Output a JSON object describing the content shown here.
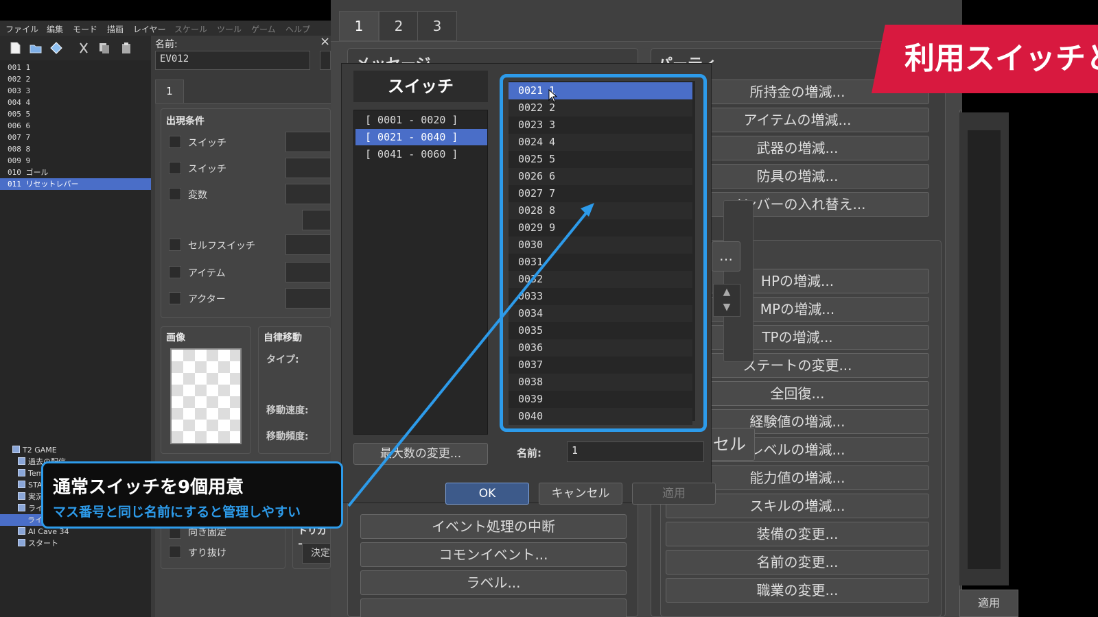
{
  "menu": {
    "items": [
      "ファイル",
      "編集",
      "モード",
      "描画",
      "レイヤー",
      "スケール",
      "ツール",
      "ゲーム",
      "ヘルプ"
    ]
  },
  "toolbar_icons": [
    "new-file-icon",
    "open-folder-icon",
    "save-icon",
    "cut-icon",
    "copy-icon",
    "paste-icon"
  ],
  "map_list": [
    {
      "label": "001 1"
    },
    {
      "label": "002 2"
    },
    {
      "label": "003 3"
    },
    {
      "label": "004 4"
    },
    {
      "label": "005 5"
    },
    {
      "label": "006 6"
    },
    {
      "label": "007 7"
    },
    {
      "label": "008 8"
    },
    {
      "label": "009 9"
    },
    {
      "label": "010 ゴール"
    },
    {
      "label": "011 リセットレバー",
      "selected": true
    }
  ],
  "project_tree": [
    {
      "label": "T2 GAME",
      "indent": 0
    },
    {
      "label": "過去の配信",
      "indent": 1
    },
    {
      "label": "Temp",
      "indent": 1
    },
    {
      "label": "STA",
      "indent": 1
    },
    {
      "label": "実況",
      "indent": 1
    },
    {
      "label": "ライ",
      "indent": 1
    },
    {
      "label": "ライ",
      "indent": 1,
      "selected": true
    },
    {
      "label": "AI Cave 34",
      "indent": 1
    },
    {
      "label": "スタート",
      "indent": 1
    }
  ],
  "event_editor": {
    "name_label": "名前:",
    "name_value": "EV012",
    "close_icon": "×",
    "page_tab": "1",
    "conditions_title": "出現条件",
    "conditions": [
      "スイッチ",
      "スイッチ",
      "変数",
      "セルフスイッチ",
      "アイテム",
      "アクター"
    ],
    "image_title": "画像",
    "autonomous_title": "自律移動",
    "type_label": "タイプ:",
    "speed_label": "移動速度:",
    "freq_label": "移動頻度:",
    "options": [
      "向き固定",
      "すり抜け"
    ],
    "trigger_title": "トリガー",
    "trigger_value": "決定"
  },
  "command_window": {
    "tabs": [
      "1",
      "2",
      "3"
    ],
    "message_title": "メッセージ",
    "party_title": "パーティ",
    "left_buttons": [
      "イベント処理の中断",
      "コモンイベント...",
      "ラベル..."
    ],
    "right_buttons": [
      "所持金の増減...",
      "アイテムの増減...",
      "武器の増減...",
      "防具の増減...",
      "メンバーの入れ替え...",
      "HPの増減...",
      "MPの増減...",
      "TPの増減...",
      "ステートの変更...",
      "全回復...",
      "経験値の増減...",
      "レベルの増減...",
      "能力値の増減...",
      "スキルの増減...",
      "装備の変更...",
      "名前の変更...",
      "職業の変更..."
    ],
    "cancel_partial": "ンセル",
    "apply_label": "適用"
  },
  "switch_dialog": {
    "title": "スイッチ",
    "groups": [
      {
        "label": "[ 0001 - 0020 ]"
      },
      {
        "label": "[ 0021 - 0040 ]",
        "selected": true
      },
      {
        "label": "[ 0041 - 0060 ]"
      }
    ],
    "switches": [
      {
        "label": "0021 1",
        "selected": true
      },
      {
        "label": "0022 2"
      },
      {
        "label": "0023 3"
      },
      {
        "label": "0024 4"
      },
      {
        "label": "0025 5"
      },
      {
        "label": "0026 6"
      },
      {
        "label": "0027 7"
      },
      {
        "label": "0028 8"
      },
      {
        "label": "0029 9"
      },
      {
        "label": "0030"
      },
      {
        "label": "0031"
      },
      {
        "label": "0032"
      },
      {
        "label": "0033"
      },
      {
        "label": "0034"
      },
      {
        "label": "0035"
      },
      {
        "label": "0036"
      },
      {
        "label": "0037"
      },
      {
        "label": "0038"
      },
      {
        "label": "0039"
      },
      {
        "label": "0040"
      }
    ],
    "max_change_label": "最大数の変更...",
    "name_label": "名前:",
    "name_value": "1",
    "ok_label": "OK",
    "cancel_label": "キャンセル",
    "apply_label": "適用"
  },
  "overlay": {
    "banner": "利用スイッチと",
    "caption_main": "通常スイッチを9個用意",
    "caption_sub": "マス番号と同じ名前にすると管理しやすい",
    "accent": "#2d9bea",
    "banner_color": "#d8193f"
  }
}
